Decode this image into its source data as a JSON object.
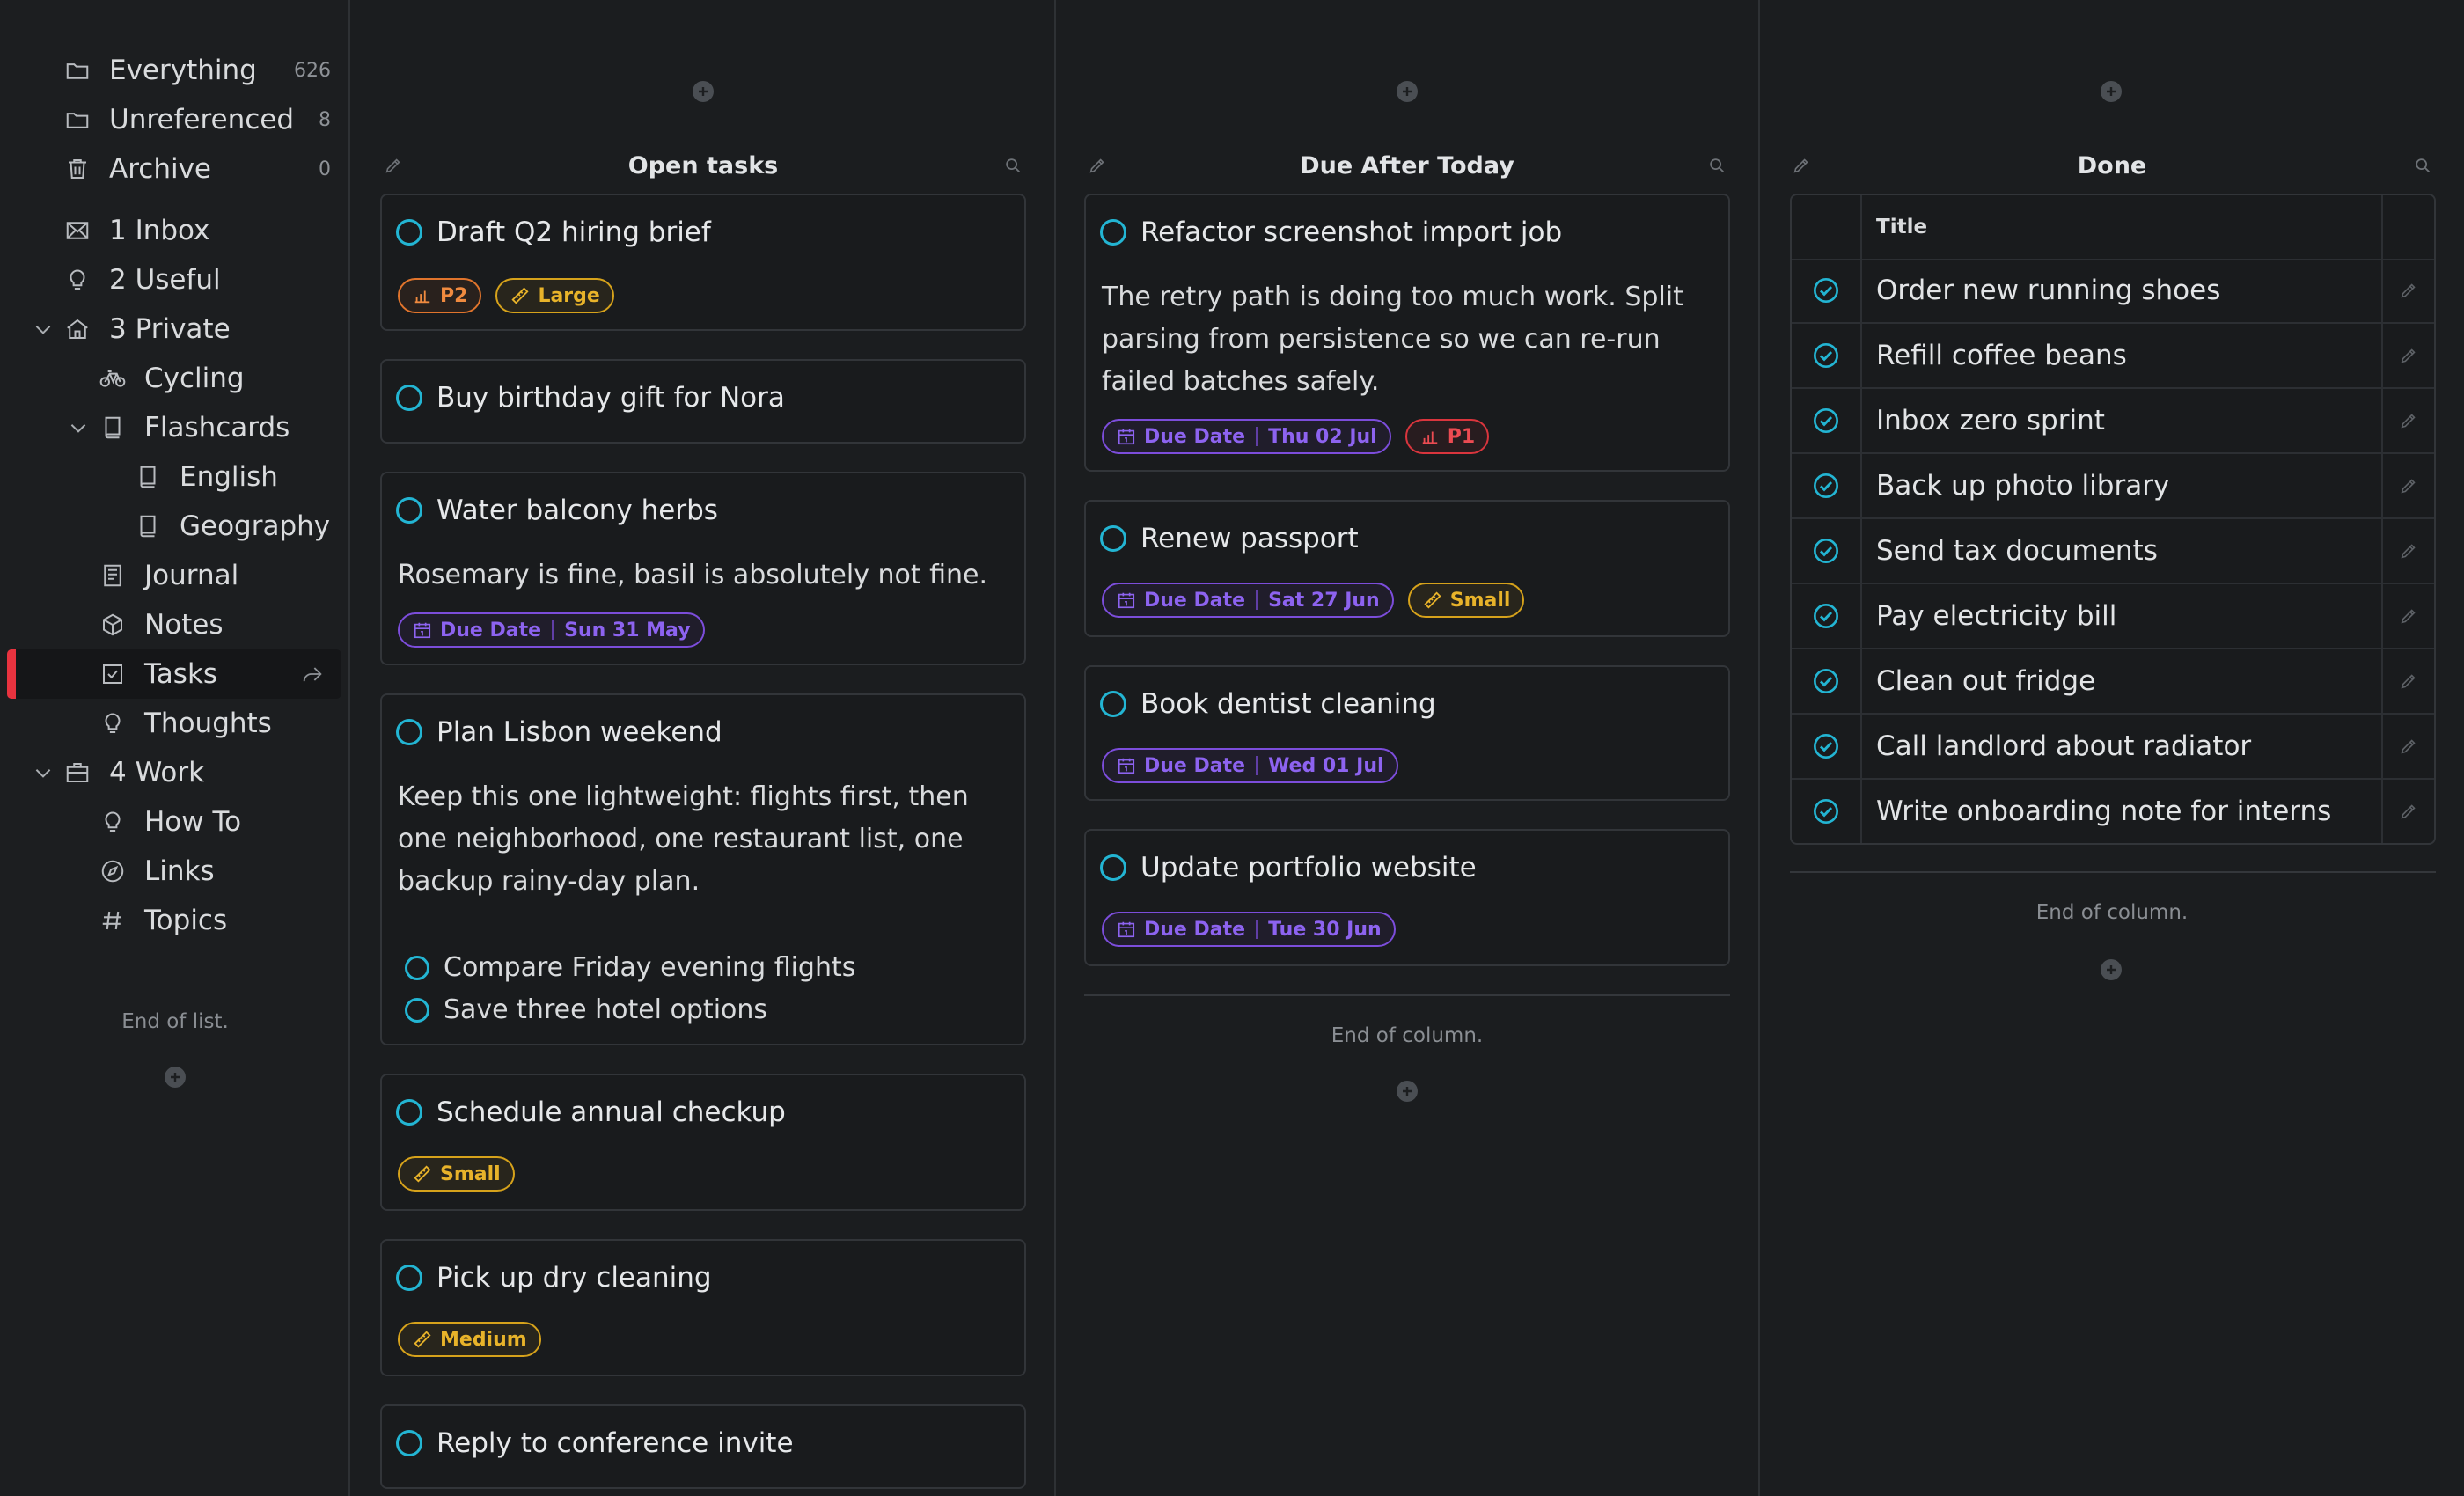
{
  "sidebar": {
    "everything": {
      "label": "Everything",
      "count": "626"
    },
    "unreferenced": {
      "label": "Unreferenced",
      "count": "8"
    },
    "archive": {
      "label": "Archive",
      "count": "0"
    },
    "inbox": "1 Inbox",
    "useful": "2 Useful",
    "private": "3 Private",
    "cycling": "Cycling",
    "flashcards": "Flashcards",
    "english": "English",
    "geography": "Geography",
    "journal": "Journal",
    "notes": "Notes",
    "tasks": "Tasks",
    "thoughts": "Thoughts",
    "work": "4 Work",
    "howto": "How To",
    "links": "Links",
    "topics": "Topics",
    "end_text": "End of list."
  },
  "columns": {
    "open": {
      "title": "Open tasks",
      "cards": [
        {
          "title": "Draft Q2 hiring brief",
          "tags": [
            "P2",
            "Large"
          ]
        },
        {
          "title": "Buy birthday gift for Nora"
        },
        {
          "title": "Water balcony herbs",
          "body": "Rosemary is fine, basil is absolutely not fine.",
          "due_label": "Due Date",
          "due_value": "Sun 31 May"
        },
        {
          "title": "Plan Lisbon weekend",
          "body": "Keep this one lightweight: flights first, then one neighborhood, one restaurant list, one backup rainy-day plan.",
          "subtasks": [
            "Compare Friday evening flights",
            "Save three hotel options"
          ]
        },
        {
          "title": "Schedule annual checkup",
          "tags": [
            "Small"
          ]
        },
        {
          "title": "Pick up dry cleaning",
          "tags": [
            "Medium"
          ]
        },
        {
          "title": "Reply to conference invite"
        }
      ]
    },
    "due": {
      "title": "Due After Today",
      "cards": [
        {
          "title": "Refactor screenshot import job",
          "body": "The retry path is doing too much work. Split parsing from persistence so we can re-run failed batches safely.",
          "due_label": "Due Date",
          "due_value": "Thu 02 Jul",
          "tag": "P1"
        },
        {
          "title": "Renew passport",
          "due_label": "Due Date",
          "due_value": "Sat 27 Jun",
          "tag": "Small"
        },
        {
          "title": "Book dentist cleaning",
          "due_label": "Due Date",
          "due_value": "Wed 01 Jul"
        },
        {
          "title": "Update portfolio website",
          "due_label": "Due Date",
          "due_value": "Tue 30 Jun"
        }
      ],
      "end_text": "End of column."
    },
    "done": {
      "title": "Done",
      "header": "Title",
      "rows": [
        "Order new running shoes",
        "Refill coffee beans",
        "Inbox zero sprint",
        "Back up photo library",
        "Send tax documents",
        "Pay electricity bill",
        "Clean out fridge",
        "Call landlord about radiator",
        "Write onboarding note for interns"
      ],
      "end_text": "End of column."
    }
  },
  "colors": {
    "accent_cyan": "#23b5d3",
    "active_marker": "#e8333f",
    "due_purple": "#8d63f0",
    "priority_orange": "#f08a3f",
    "size_yellow": "#e8b32a",
    "priority_red": "#ec4b52"
  }
}
